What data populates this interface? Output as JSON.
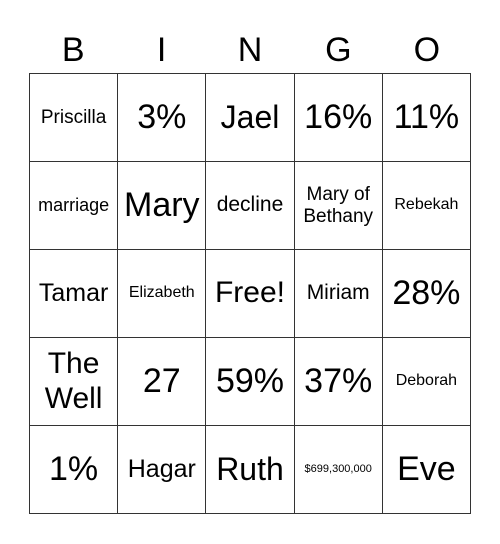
{
  "header": [
    "B",
    "I",
    "N",
    "G",
    "O"
  ],
  "cells": [
    [
      "Priscilla",
      "3%",
      "Jael",
      "16%",
      "11%"
    ],
    [
      "marriage",
      "Mary",
      "decline",
      "Mary of Bethany",
      "Rebekah"
    ],
    [
      "Tamar",
      "Elizabeth",
      "Free!",
      "Miriam",
      "28%"
    ],
    [
      "The Well",
      "27",
      "59%",
      "37%",
      "Deborah"
    ],
    [
      "1%",
      "Hagar",
      "Ruth",
      "$699,300,000",
      "Eve"
    ]
  ]
}
